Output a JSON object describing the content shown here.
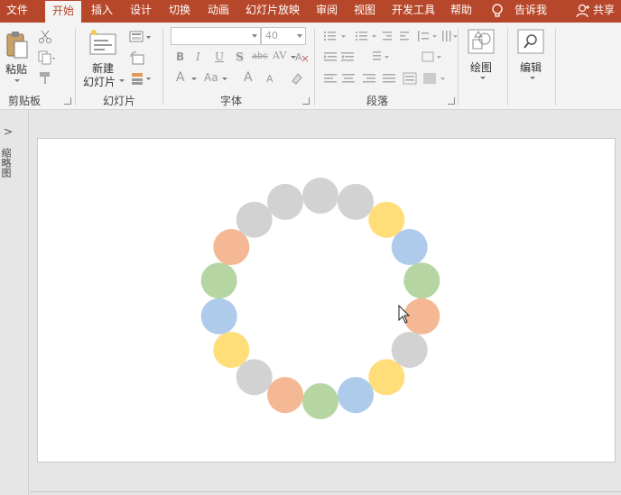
{
  "menu": {
    "tabs": [
      {
        "label": "文件"
      },
      {
        "label": "开始",
        "active": true
      },
      {
        "label": "插入"
      },
      {
        "label": "设计"
      },
      {
        "label": "切换"
      },
      {
        "label": "动画"
      },
      {
        "label": "幻灯片放映"
      },
      {
        "label": "审阅"
      },
      {
        "label": "视图"
      },
      {
        "label": "开发工具"
      },
      {
        "label": "帮助"
      }
    ],
    "tell_me": "告诉我",
    "share": "共享"
  },
  "ribbon": {
    "clipboard": {
      "paste_label": "粘贴",
      "group_label": "剪贴板"
    },
    "slides": {
      "new_slide_line1": "新建",
      "new_slide_line2": "幻灯片",
      "group_label": "幻灯片"
    },
    "font": {
      "font_name": "",
      "font_size": "40",
      "group_label": "字体"
    },
    "paragraph": {
      "group_label": "段落"
    },
    "drawing": {
      "label": "绘图"
    },
    "editing": {
      "label": "编辑"
    }
  },
  "thumbnail_pane": {
    "label": "缩略图"
  },
  "slide": {
    "circle_count": 18,
    "colors": {
      "gray": "#d2d2d2",
      "yellow": "#ffde7a",
      "blue": "#aecbeb",
      "green": "#b5d6a3",
      "orange": "#f4b894"
    },
    "circle_colors": [
      "gray",
      "gray",
      "yellow",
      "blue",
      "green",
      "orange",
      "gray",
      "yellow",
      "blue",
      "green",
      "orange",
      "gray",
      "yellow",
      "blue",
      "green",
      "orange",
      "gray",
      "gray"
    ]
  },
  "theme": {
    "accent": "#b7472a",
    "ribbon_bg": "#f3f3f3",
    "workspace_bg": "#e6e6e6"
  }
}
